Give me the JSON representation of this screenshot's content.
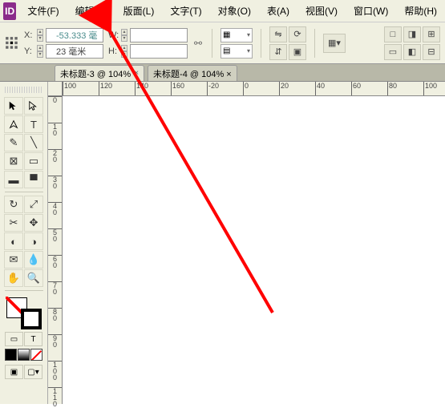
{
  "logo": "ID",
  "menu": [
    "文件(F)",
    "编辑(E)",
    "版面(L)",
    "文字(T)",
    "对象(O)",
    "表(A)",
    "视图(V)",
    "窗口(W)",
    "帮助(H)"
  ],
  "coords": {
    "x_label": "X:",
    "x_value": "-53.333 毫",
    "y_label": "Y:",
    "y_value": "23 毫米",
    "w_label": "W:",
    "w_value": "",
    "h_label": "H:",
    "h_value": ""
  },
  "tabs": [
    {
      "label": "未标题-3 @ 104%",
      "active": true
    },
    {
      "label": "未标题-4 @ 104% ×",
      "active": false
    }
  ],
  "ruler_h": [
    "100",
    "120",
    "140",
    "160",
    "-20",
    "0",
    "20",
    "40",
    "60",
    "80",
    "100"
  ],
  "ruler_v": [
    "0",
    "10",
    "20",
    "30",
    "40",
    "50",
    "60",
    "70",
    "80",
    "90",
    "100",
    "110"
  ]
}
